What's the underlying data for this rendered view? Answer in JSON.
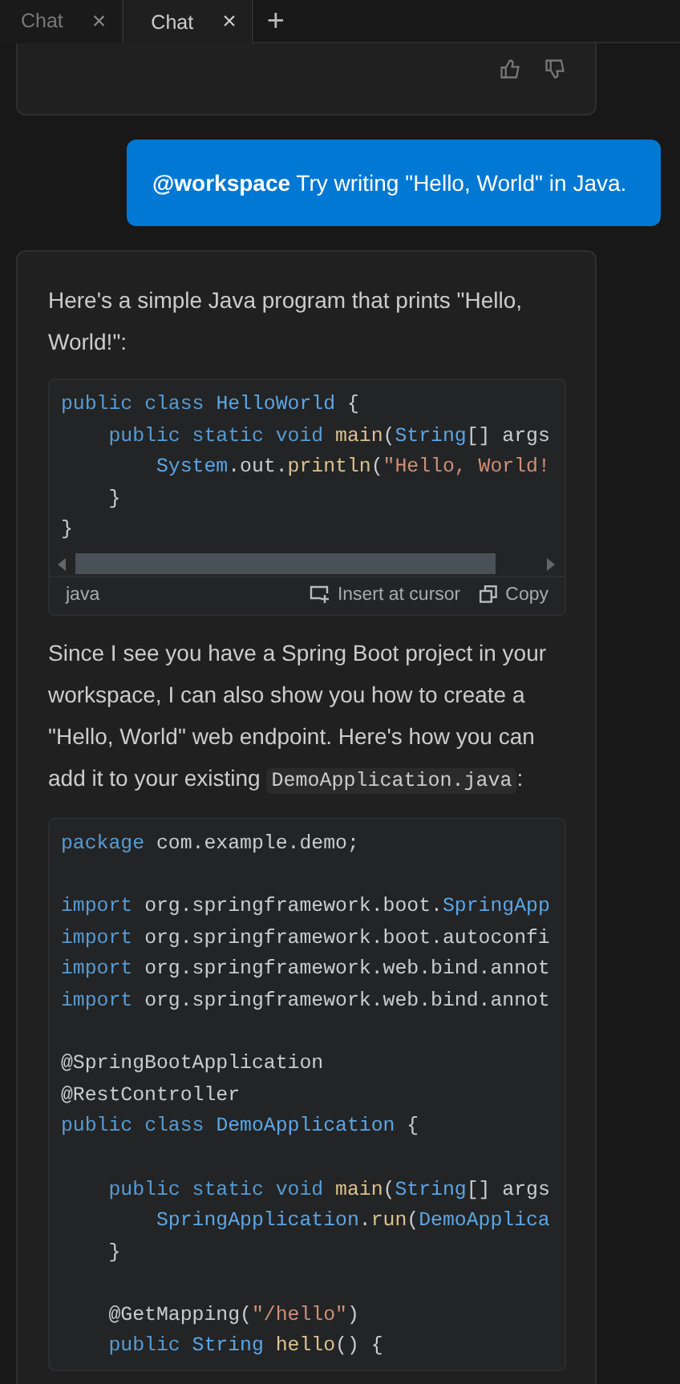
{
  "tabs": [
    {
      "label": "Chat",
      "close": "×",
      "selected": false
    },
    {
      "label": "Chat",
      "close": "×",
      "selected": true
    }
  ],
  "new_tab": "+",
  "messages": [
    {
      "kind": "feedback"
    },
    {
      "kind": "user",
      "mention": "@workspace",
      "text": "Try writing \"Hello, World\" in Java."
    },
    {
      "kind": "response",
      "blocks": [
        {
          "kind": "text",
          "parts": [
            {
              "kind": "text",
              "t": "Here's a simple Java program that prints \"Hello, World!\":"
            }
          ]
        },
        {
          "kind": "code",
          "language": "java",
          "actions": [
            "Insert at cursor",
            "Copy"
          ],
          "lines": [
            {
              "kind": "code",
              "tokens": [
                {
                  "kind": "kw",
                  "t": "public "
                },
                {
                  "kind": "kw",
                  "t": "class "
                },
                {
                  "kind": "type",
                  "t": "HelloWorld"
                },
                {
                  "kind": "plain",
                  "t": " {"
                }
              ]
            },
            {
              "kind": "code",
              "tokens": [
                {
                  "kind": "kw",
                  "t": "    public "
                },
                {
                  "kind": "kw",
                  "t": "static "
                },
                {
                  "kind": "kw",
                  "t": "void "
                },
                {
                  "kind": "fn",
                  "t": "main"
                },
                {
                  "kind": "plain",
                  "t": "("
                },
                {
                  "kind": "type",
                  "t": "String"
                },
                {
                  "kind": "plain",
                  "t": "[] args"
                }
              ]
            },
            {
              "kind": "code",
              "tokens": [
                {
                  "kind": "type",
                  "t": "        System"
                },
                {
                  "kind": "plain",
                  "t": ".out."
                },
                {
                  "kind": "fn",
                  "t": "println"
                },
                {
                  "kind": "plain",
                  "t": "("
                },
                {
                  "kind": "str",
                  "t": "\"Hello, World!"
                }
              ]
            },
            {
              "kind": "code",
              "tokens": [
                {
                  "kind": "plain",
                  "t": "    }"
                }
              ]
            },
            {
              "kind": "code",
              "tokens": [
                {
                  "kind": "plain",
                  "t": "}"
                }
              ]
            }
          ]
        },
        {
          "kind": "text",
          "parts": [
            {
              "kind": "text",
              "t": "Since I see you have a Spring Boot project in your workspace, I can also show you how to create a \"Hello, World\" web endpoint. Here's how you can add it to your existing "
            },
            {
              "kind": "code",
              "t": "DemoApplication.java"
            },
            {
              "kind": "text",
              "t": ":"
            }
          ]
        },
        {
          "kind": "code",
          "lines": [
            {
              "kind": "code",
              "tokens": [
                {
                  "kind": "kw",
                  "t": "package "
                },
                {
                  "kind": "plain",
                  "t": "com.example.demo;"
                }
              ]
            },
            {
              "kind": "blank"
            },
            {
              "kind": "code",
              "tokens": [
                {
                  "kind": "kw",
                  "t": "import "
                },
                {
                  "kind": "plain",
                  "t": "org.springframework.boot."
                },
                {
                  "kind": "type",
                  "t": "SpringApp"
                }
              ]
            },
            {
              "kind": "code",
              "tokens": [
                {
                  "kind": "kw",
                  "t": "import "
                },
                {
                  "kind": "plain",
                  "t": "org.springframework.boot.autoconfi"
                }
              ]
            },
            {
              "kind": "code",
              "tokens": [
                {
                  "kind": "kw",
                  "t": "import "
                },
                {
                  "kind": "plain",
                  "t": "org.springframework.web.bind.annot"
                }
              ]
            },
            {
              "kind": "code",
              "tokens": [
                {
                  "kind": "kw",
                  "t": "import "
                },
                {
                  "kind": "plain",
                  "t": "org.springframework.web.bind.annot"
                }
              ]
            },
            {
              "kind": "blank"
            },
            {
              "kind": "code",
              "tokens": [
                {
                  "kind": "plain",
                  "t": "@SpringBootApplication"
                }
              ]
            },
            {
              "kind": "code",
              "tokens": [
                {
                  "kind": "plain",
                  "t": "@RestController"
                }
              ]
            },
            {
              "kind": "code",
              "tokens": [
                {
                  "kind": "kw",
                  "t": "public "
                },
                {
                  "kind": "kw",
                  "t": "class "
                },
                {
                  "kind": "type",
                  "t": "DemoApplication"
                },
                {
                  "kind": "plain",
                  "t": " {"
                }
              ]
            },
            {
              "kind": "blank"
            },
            {
              "kind": "code",
              "tokens": [
                {
                  "kind": "kw",
                  "t": "    public "
                },
                {
                  "kind": "kw",
                  "t": "static "
                },
                {
                  "kind": "kw",
                  "t": "void "
                },
                {
                  "kind": "fn",
                  "t": "main"
                },
                {
                  "kind": "plain",
                  "t": "("
                },
                {
                  "kind": "type",
                  "t": "String"
                },
                {
                  "kind": "plain",
                  "t": "[] args"
                }
              ]
            },
            {
              "kind": "code",
              "tokens": [
                {
                  "kind": "type",
                  "t": "        SpringApplication"
                },
                {
                  "kind": "plain",
                  "t": "."
                },
                {
                  "kind": "fn",
                  "t": "run"
                },
                {
                  "kind": "plain",
                  "t": "("
                },
                {
                  "kind": "type",
                  "t": "DemoApplica"
                }
              ]
            },
            {
              "kind": "code",
              "tokens": [
                {
                  "kind": "plain",
                  "t": "    }"
                }
              ]
            },
            {
              "kind": "blank"
            },
            {
              "kind": "code",
              "tokens": [
                {
                  "kind": "plain",
                  "t": "    @GetMapping("
                },
                {
                  "kind": "str",
                  "t": "\"/hello\""
                },
                {
                  "kind": "plain",
                  "t": ")"
                }
              ]
            },
            {
              "kind": "code",
              "tokens": [
                {
                  "kind": "kw",
                  "t": "    public "
                },
                {
                  "kind": "type",
                  "t": "String "
                },
                {
                  "kind": "fn",
                  "t": "hello"
                },
                {
                  "kind": "plain",
                  "t": "() {"
                }
              ]
            }
          ]
        }
      ]
    }
  ]
}
